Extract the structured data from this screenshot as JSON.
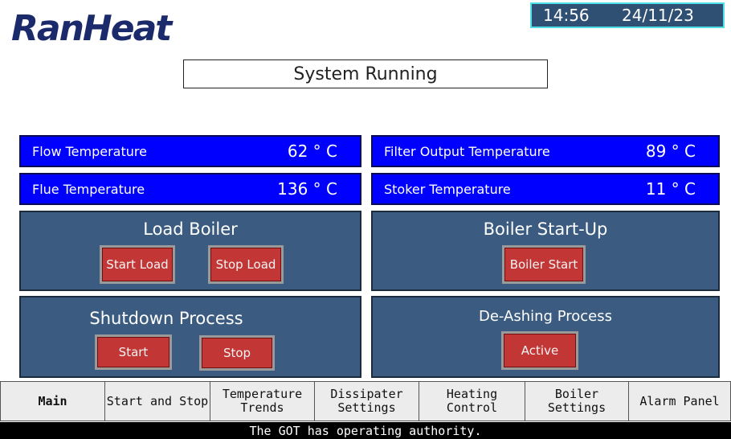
{
  "header": {
    "logo_text": "RanHeat",
    "clock": {
      "time": "14:56",
      "date": "24/11/23"
    }
  },
  "status_text": "System Running",
  "temperatures": [
    {
      "label": "Flow Temperature",
      "value": "62 ° C"
    },
    {
      "label": "Filter Output Temperature",
      "value": "89 ° C"
    },
    {
      "label": "Flue Temperature",
      "value": "136 ° C"
    },
    {
      "label": "Stoker Temperature",
      "value": "11 ° C"
    }
  ],
  "load_boiler": {
    "title": "Load Boiler",
    "start_label": "Start Load",
    "stop_label": "Stop Load"
  },
  "boiler_startup": {
    "title": "Boiler Start-Up",
    "start_label": "Boiler Start"
  },
  "shutdown": {
    "title": "Shutdown Process",
    "start_label": "Start",
    "stop_label": "Stop"
  },
  "deashing": {
    "title": "De-Ashing Process",
    "active_label": "Active"
  },
  "nav": {
    "items": [
      {
        "label": "Main"
      },
      {
        "label": "Start and Stop"
      },
      {
        "label": "Temperature Trends"
      },
      {
        "label": "Dissipater Settings"
      },
      {
        "label": "Heating Control"
      },
      {
        "label": "Boiler Settings"
      },
      {
        "label": "Alarm Panel"
      }
    ]
  },
  "footer_text": "The GOT has operating authority.",
  "colors": {
    "temp_bg": "#0000ff",
    "panel_bg": "#3b5c80",
    "button_red": "#c23636",
    "clock_border": "#4fe0ea"
  }
}
